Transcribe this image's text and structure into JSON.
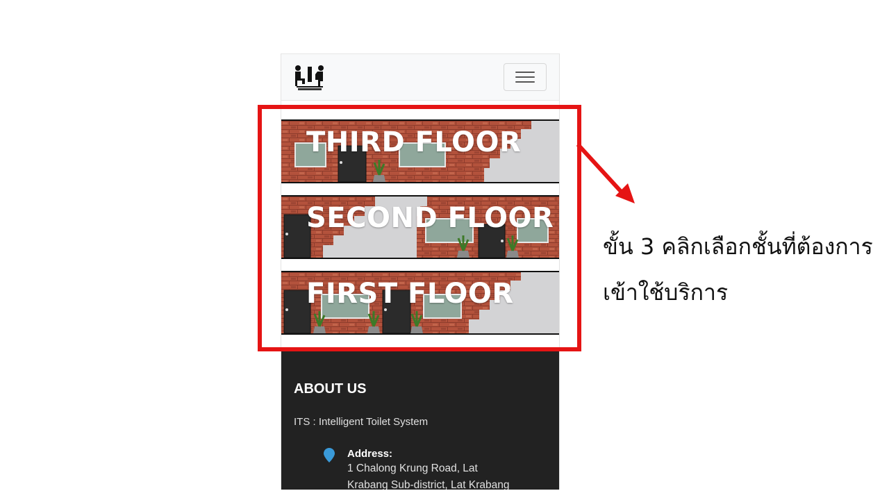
{
  "navbar": {
    "logo_icon": "toilet-system-logo-icon",
    "menu_icon": "hamburger-menu-icon"
  },
  "floors": [
    {
      "label": "THIRD FLOOR"
    },
    {
      "label": "SECOND FLOOR"
    },
    {
      "label": "FIRST FLOOR"
    }
  ],
  "footer": {
    "title": "ABOUT US",
    "description": "ITS : Intelligent Toilet System",
    "address_icon": "location-pin-icon",
    "address_label": "Address:",
    "address_lines": [
      "1 Chalong Krung Road, Lat",
      "Krabang Sub-district, Lat Krabang"
    ]
  },
  "annotation": {
    "line1": "ขั้น 3 คลิกเลือกชั้นที่ต้องการ",
    "line2": "เข้าใช้บริการ",
    "highlight_color": "#e51414"
  },
  "colors": {
    "brick": "#b3523c",
    "footer_bg": "#222222",
    "navbar_bg": "#f8f9fa",
    "pin": "#3a9ad9"
  }
}
